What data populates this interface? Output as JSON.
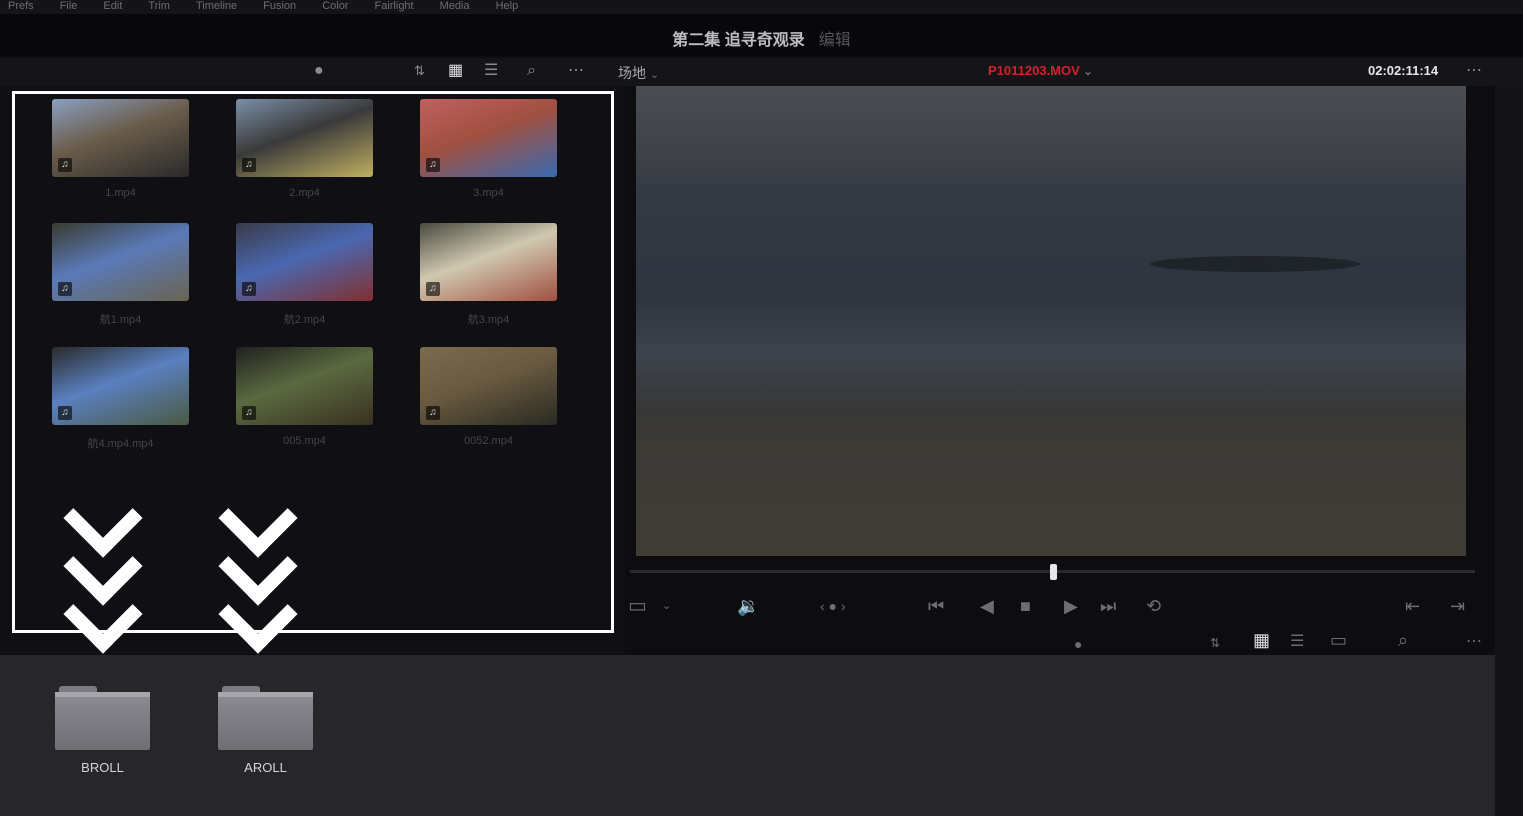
{
  "menubar": {
    "items": [
      "Prefs",
      "File",
      "Edit",
      "Trim",
      "Timeline",
      "Fusion",
      "Color",
      "Fairlight",
      "Media",
      "Help"
    ]
  },
  "project": {
    "title": "第二集 追寻奇观录",
    "subtitle": "编辑"
  },
  "toolbar": {
    "bin_label": "场地",
    "clip_name": "P1011203.MOV",
    "timecode": "02:02:11:14"
  },
  "media_pool": {
    "clips": [
      {
        "label": "1.mp4",
        "colors": [
          "#6a5c4a",
          "#2a2a2a",
          "#8aa0c0"
        ]
      },
      {
        "label": "2.mp4",
        "colors": [
          "#3a3a3a",
          "#c0b060",
          "#7a8fa8"
        ]
      },
      {
        "label": "3.mp4",
        "colors": [
          "#a05040",
          "#3a6ab0",
          "#c06060"
        ]
      },
      {
        "label": "航1.mp4",
        "colors": [
          "#5a7ab8",
          "#6a6450",
          "#3a3a30"
        ]
      },
      {
        "label": "航2.mp4",
        "colors": [
          "#4a68b0",
          "#803030",
          "#3a3a48"
        ]
      },
      {
        "label": "航3.mp4",
        "colors": [
          "#d0c8b0",
          "#a05040",
          "#4a4a40"
        ]
      },
      {
        "label": "航4.mp4.mp4",
        "colors": [
          "#5a80c0",
          "#4a5a40",
          "#2a2a2a"
        ]
      },
      {
        "label": "005.mp4",
        "colors": [
          "#5a6a40",
          "#3a3020",
          "#202020"
        ]
      },
      {
        "label": "0052.mp4",
        "colors": [
          "#6a5a40",
          "#2a2a22",
          "#7a6a50"
        ]
      }
    ]
  },
  "lower_bin": {
    "folders": [
      {
        "label": "BROLL"
      },
      {
        "label": "AROLL"
      }
    ]
  },
  "colors": {
    "accent_red": "#d0222d",
    "highlight": "#ffffff"
  }
}
